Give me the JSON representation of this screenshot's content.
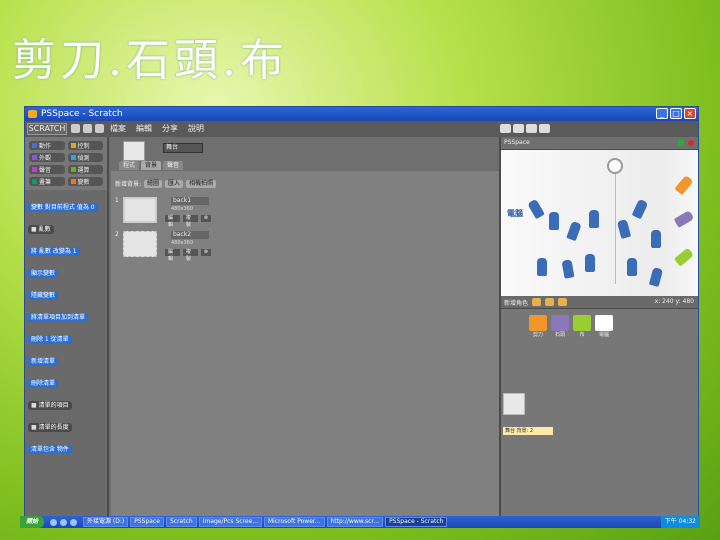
{
  "slide": {
    "title": "剪刀.石頭.布"
  },
  "window": {
    "title": "PSSpace - Scratch",
    "buttons": [
      "_",
      "□",
      "×"
    ]
  },
  "menubar": {
    "logo": "SCRATCH",
    "items": [
      "檔案",
      "編輯",
      "分享",
      "說明"
    ]
  },
  "palette": {
    "categories": [
      {
        "label": "動作",
        "color": "#4a6cd4"
      },
      {
        "label": "控制",
        "color": "#e1a91a"
      },
      {
        "label": "外觀",
        "color": "#8a55d7"
      },
      {
        "label": "偵測",
        "color": "#2ca5e2"
      },
      {
        "label": "聲音",
        "color": "#bb42c3"
      },
      {
        "label": "運算",
        "color": "#5cb712"
      },
      {
        "label": "畫筆",
        "color": "#0e9a6c"
      },
      {
        "label": "變數",
        "color": "#ee7d16"
      }
    ],
    "blocks": [
      "變數 對目前程式 值為 0",
      "亂數",
      "將 亂數 改變為 1",
      "顯示變數",
      "隱藏變數",
      "將清單項目加到清單",
      "刪除 1 從清單",
      "新增清單",
      "刪除清單",
      "清單的項目",
      "清單的長度",
      "清單包含 物件"
    ]
  },
  "sprite": {
    "name": "舞台",
    "tabs": [
      "程式",
      "背景",
      "聲音"
    ],
    "active_tab": 1
  },
  "costumes": {
    "toolbar": [
      "新增背景:",
      "繪圖",
      "匯入",
      "相機拍照"
    ],
    "items": [
      {
        "index": "1",
        "name": "back1",
        "size": "480x360",
        "edit": "編輯",
        "copy": "複製"
      },
      {
        "index": "2",
        "name": "back2",
        "size": "480x360",
        "edit": "編輯",
        "copy": "複製"
      }
    ]
  },
  "stage": {
    "title": "PSSpace",
    "label": "電腦",
    "coords": "x: 240  y: 480"
  },
  "sprite_list": {
    "title": "新增角色",
    "items": [
      "剪刀",
      "石頭",
      "布",
      "電腦"
    ],
    "stage_tag": "舞台 背景: 2"
  },
  "taskbar": {
    "start": "開始",
    "tasks": [
      "外接電源 (D:)",
      "PSSpace",
      "Scratch",
      "Image/Pcs Scree...",
      "Microsoft Power...",
      "http://www.scr...",
      "PSSpace - Scratch"
    ],
    "active_task": 6,
    "clock": "下午 04:32"
  }
}
